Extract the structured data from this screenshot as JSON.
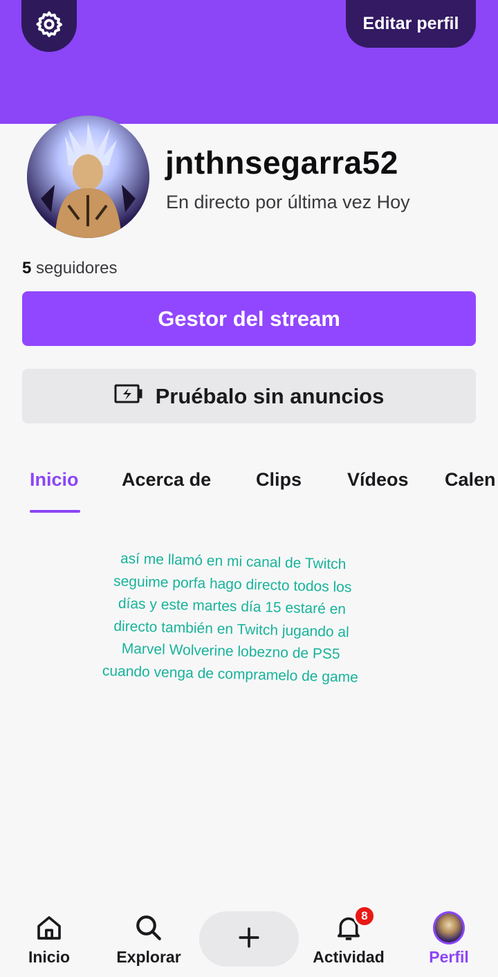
{
  "header": {
    "bg_color": "#8c45f7",
    "settings_icon": "gear-icon",
    "edit_profile_label": "Editar perfil"
  },
  "profile": {
    "username": "jnthnsegarra52",
    "last_live": "En directo por última vez Hoy",
    "followers_count": "5",
    "followers_label": "seguidores"
  },
  "actions": {
    "stream_manager_label": "Gestor del stream",
    "no_ads_label": "Pruébalo sin anuncios",
    "no_ads_icon": "battery-charging-icon"
  },
  "tabs": [
    {
      "label": "Inicio",
      "active": true
    },
    {
      "label": "Acerca de",
      "active": false
    },
    {
      "label": "Clips",
      "active": false
    },
    {
      "label": "Vídeos",
      "active": false
    },
    {
      "label": "Calen",
      "active": false
    }
  ],
  "bio": {
    "lines": [
      "así me llamó en mi canal de Twitch",
      "seguime porfa hago directo todos los",
      "días y este martes día 15 estaré en",
      "directo también en Twitch jugando al",
      "Marvel Wolverine lobezno de PS5",
      "cuando venga de compramelo de game"
    ],
    "color": "#19b39a"
  },
  "bottom_nav": {
    "items": [
      {
        "label": "Inicio",
        "icon": "home-icon"
      },
      {
        "label": "Explorar",
        "icon": "search-icon"
      },
      {
        "label": "",
        "icon": "plus-icon"
      },
      {
        "label": "Actividad",
        "icon": "bell-icon",
        "badge": "8"
      },
      {
        "label": "Perfil",
        "icon": "avatar"
      }
    ]
  },
  "colors": {
    "accent": "#8c45f7",
    "badge": "#e91916"
  }
}
